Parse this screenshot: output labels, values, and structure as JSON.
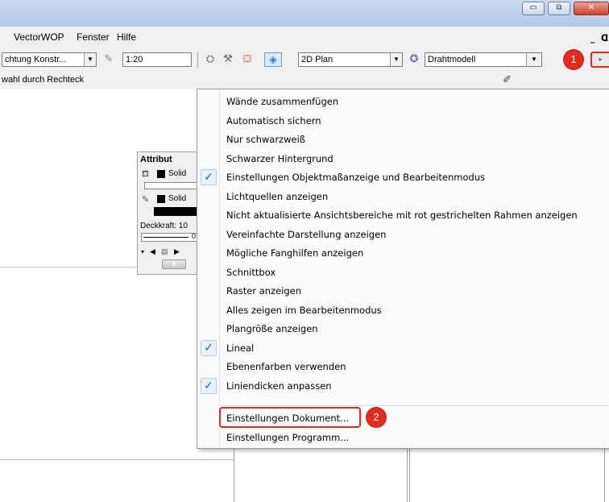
{
  "window": {
    "min_glyph": "▭",
    "restore_glyph": "⧉",
    "close_glyph": "✕",
    "inner_min_glyph": "_",
    "inner_restore_glyph": "ᗡ"
  },
  "menubar": {
    "items": [
      "VectorWOP",
      "Fenster",
      "Hilfe"
    ]
  },
  "toolbar": {
    "view_combo": "chtung Konstr...",
    "scale_value": "1:20",
    "plan_combo": "2D Plan",
    "render_combo": "Drahtmodell"
  },
  "statusbar": {
    "mode_text": "wahl durch Rechteck"
  },
  "attributes": {
    "title": "Attribut",
    "fill_label": "Solid",
    "line_label": "Solid",
    "opacity_label": "Deckkraft: 10",
    "slider_value": "0"
  },
  "menu": {
    "items": [
      {
        "label": "Wände zusammenfügen",
        "checked": false
      },
      {
        "label": "Automatisch sichern",
        "checked": false
      },
      {
        "label": "Nur schwarzweiß",
        "checked": false
      },
      {
        "label": "Schwarzer Hintergrund",
        "checked": false
      },
      {
        "label": "Einstellungen Objektmaßanzeige und Bearbeitenmodus",
        "checked": true
      },
      {
        "label": "Lichtquellen anzeigen",
        "checked": false
      },
      {
        "label": "Nicht aktualisierte Ansichtsbereiche mit rot gestrichelten Rahmen anzeigen",
        "checked": false
      },
      {
        "label": "Vereinfachte Darstellung anzeigen",
        "checked": false
      },
      {
        "label": "Mögliche Fanghilfen anzeigen",
        "checked": false
      },
      {
        "label": "Schnittbox",
        "checked": false
      },
      {
        "label": "Raster anzeigen",
        "checked": false
      },
      {
        "label": "Alles zeigen im Bearbeitenmodus",
        "checked": false
      },
      {
        "label": "Plangröße anzeigen",
        "checked": false
      },
      {
        "label": "Lineal",
        "checked": true
      },
      {
        "label": "Ebenenfarben verwenden",
        "checked": false
      },
      {
        "label": "Liniendicken anpassen",
        "checked": true
      }
    ],
    "doc_settings": "Einstellungen Dokument...",
    "prog_settings": "Einstellungen Programm...",
    "check_glyph": "✓"
  },
  "badges": {
    "one": "1",
    "two": "2"
  },
  "colors": {
    "highlight_red": "#e02b20",
    "check_blue": "#1a5fb4"
  }
}
